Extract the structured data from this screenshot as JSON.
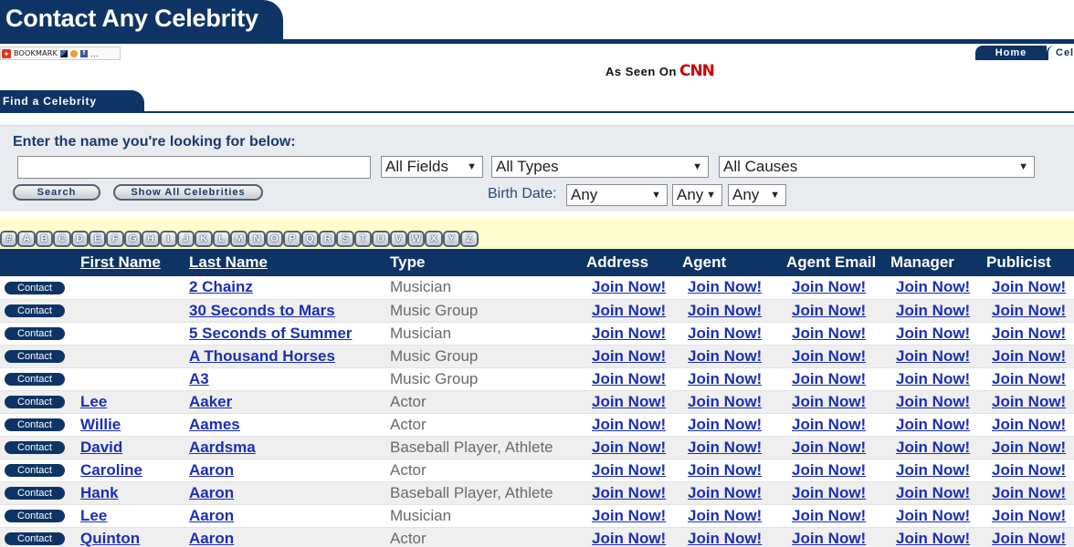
{
  "header": {
    "title": "Contact Any Celebrity"
  },
  "bookmark": {
    "label": "BOOKMARK",
    "icons": [
      "plus-icon",
      "delicious-icon",
      "digg-icon",
      "facebook-icon"
    ]
  },
  "nav": {
    "home_label": "Home",
    "second_label": "Cel"
  },
  "seen_on": {
    "text": "As Seen On",
    "brand": "CNN"
  },
  "find_tab": {
    "label": "Find a Celebrity"
  },
  "search": {
    "prompt": "Enter the name you're looking for below:",
    "name_value": "",
    "fields_value": "All Fields",
    "types_value": "All Types",
    "causes_value": "All Causes",
    "birth_label": "Birth Date:",
    "birth_month": "Any",
    "birth_day": "Any",
    "birth_year": "Any",
    "search_label": "Search",
    "show_all_label": "Show All Celebrities"
  },
  "alphabet": [
    "#",
    "A",
    "B",
    "C",
    "D",
    "E",
    "F",
    "G",
    "H",
    "I",
    "J",
    "K",
    "L",
    "M",
    "N",
    "O",
    "P",
    "Q",
    "R",
    "S",
    "T",
    "U",
    "V",
    "W",
    "X",
    "Y",
    "Z"
  ],
  "table": {
    "headers": [
      "",
      "First Name",
      "Last Name",
      "Type",
      "Address",
      "Agent",
      "Agent Email",
      "Manager",
      "Publicist"
    ],
    "contact_label": "Contact",
    "join_label": "Join Now!",
    "rows": [
      {
        "first": "",
        "last": "2 Chainz",
        "type": "Musician"
      },
      {
        "first": "",
        "last": "30 Seconds to Mars",
        "type": "Music Group"
      },
      {
        "first": "",
        "last": "5 Seconds of Summer",
        "type": "Musician"
      },
      {
        "first": "",
        "last": "A Thousand Horses",
        "type": "Music Group"
      },
      {
        "first": "",
        "last": "A3",
        "type": "Music Group"
      },
      {
        "first": "Lee",
        "last": "Aaker",
        "type": "Actor"
      },
      {
        "first": "Willie",
        "last": "Aames",
        "type": "Actor"
      },
      {
        "first": "David",
        "last": "Aardsma",
        "type": "Baseball Player, Athlete"
      },
      {
        "first": "Caroline",
        "last": "Aaron",
        "type": "Actor"
      },
      {
        "first": "Hank",
        "last": "Aaron",
        "type": "Baseball Player, Athlete"
      },
      {
        "first": "Lee",
        "last": "Aaron",
        "type": "Musician"
      },
      {
        "first": "Quinton",
        "last": "Aaron",
        "type": "Actor"
      }
    ]
  },
  "colors": {
    "navy": "#0e3466",
    "link": "#1a2fb5",
    "alpha_bg": "#fffccf",
    "panel_bg": "#e8ecf1"
  }
}
